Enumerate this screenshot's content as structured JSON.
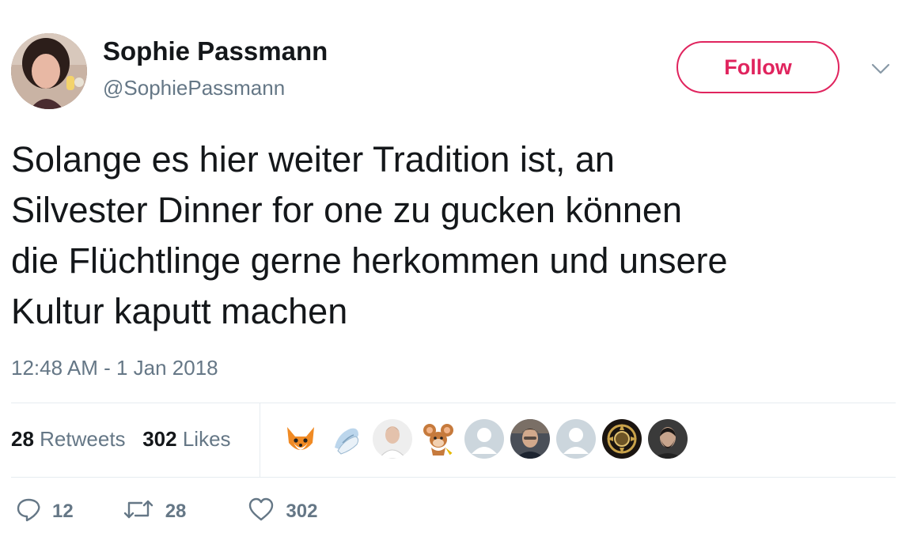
{
  "author": {
    "name": "Sophie Passmann",
    "handle": "@SophiePassmann"
  },
  "follow_label": "Follow",
  "tweet": {
    "lines": [
      "Solange es hier weiter Tradition ist, an",
      "Silvester Dinner for one zu gucken können",
      "die Flüchtlinge gerne herkommen und unsere",
      "Kultur kaputt machen"
    ],
    "timestamp": "12:48 AM - 1 Jan 2018"
  },
  "stats": {
    "retweets_count": "28",
    "retweets_label": "Retweets",
    "likes_count": "302",
    "likes_label": "Likes"
  },
  "likers": [
    {
      "name": "fox-emoji-avatar"
    },
    {
      "name": "hands-avatar"
    },
    {
      "name": "man-portrait-avatar"
    },
    {
      "name": "cartoon-mouse-avatar"
    },
    {
      "name": "default-avatar"
    },
    {
      "name": "man-dark-portrait-avatar"
    },
    {
      "name": "default-avatar"
    },
    {
      "name": "emblem-avatar"
    },
    {
      "name": "bearded-man-avatar"
    }
  ],
  "actions": {
    "reply_count": "12",
    "retweet_count": "28",
    "like_count": "302"
  },
  "colors": {
    "accent": "#e0245e",
    "text": "#14171a",
    "muted": "#657786",
    "divider": "#e6ecf0"
  }
}
